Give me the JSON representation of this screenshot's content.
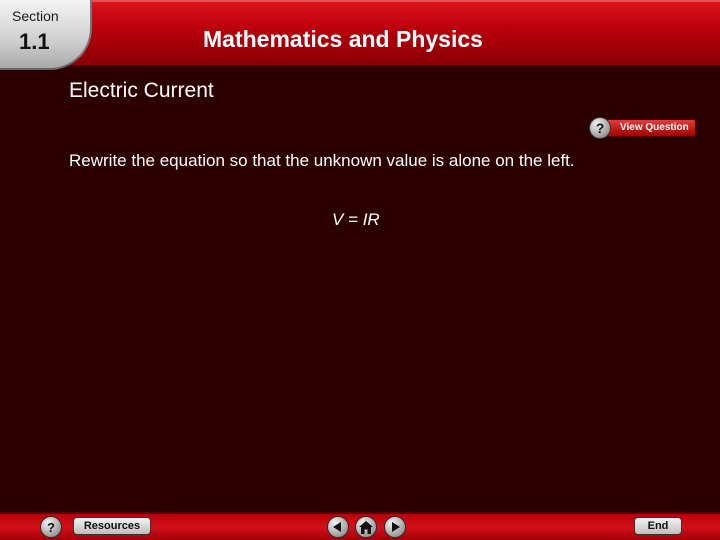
{
  "header": {
    "section_label": "Section",
    "section_number": "1.1",
    "title": "Mathematics and Physics"
  },
  "main": {
    "topic_title": "Electric Current",
    "view_question_icon": "?",
    "view_question_label": "View Question",
    "prompt": "Rewrite the equation so that the unknown value is alone on the left.",
    "equation": "V = IR"
  },
  "footer": {
    "help_icon": "?",
    "resources_label": "Resources",
    "end_label": "End"
  },
  "icons": {
    "prev": "triangle-left-icon",
    "home": "home-icon",
    "next": "triangle-right-icon"
  },
  "colors": {
    "header_red": "#c4000c",
    "background": "#2d0000",
    "text": "#ffffff"
  }
}
